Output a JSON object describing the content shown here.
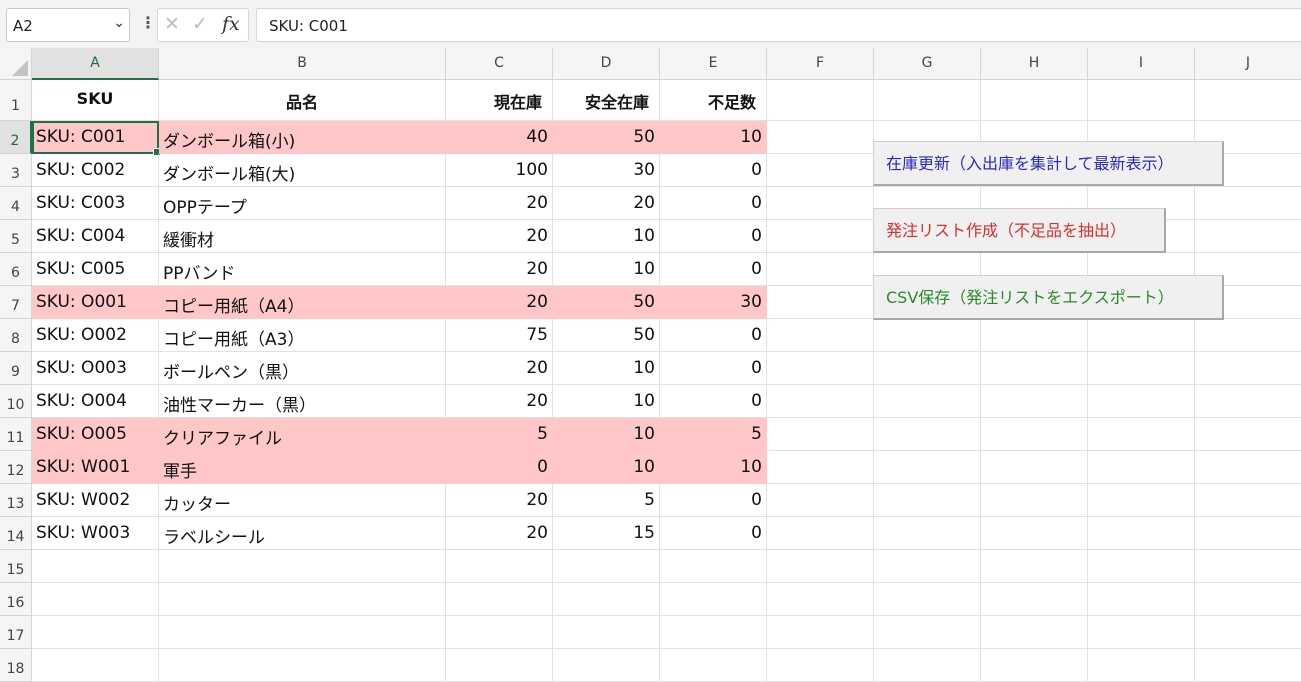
{
  "formula_bar": {
    "name_box": "A2",
    "formula": "SKU: C001"
  },
  "columns": [
    "A",
    "B",
    "C",
    "D",
    "E",
    "F",
    "G",
    "H",
    "I",
    "J"
  ],
  "rows": [
    "1",
    "2",
    "3",
    "4",
    "5",
    "6",
    "7",
    "8",
    "9",
    "10",
    "11",
    "12",
    "13",
    "14",
    "15",
    "16",
    "17",
    "18"
  ],
  "header": {
    "sku": "SKU",
    "name": "品名",
    "stock": "現在庫",
    "safety": "安全在庫",
    "shortage": "不足数"
  },
  "items": [
    {
      "sku": "SKU: C001",
      "name": "ダンボール箱(小)",
      "stock": "40",
      "safety": "50",
      "shortage": "10",
      "low": true
    },
    {
      "sku": "SKU: C002",
      "name": "ダンボール箱(大)",
      "stock": "100",
      "safety": "30",
      "shortage": "0",
      "low": false
    },
    {
      "sku": "SKU: C003",
      "name": "OPPテープ",
      "stock": "20",
      "safety": "20",
      "shortage": "0",
      "low": false
    },
    {
      "sku": "SKU: C004",
      "name": "緩衝材",
      "stock": "20",
      "safety": "10",
      "shortage": "0",
      "low": false
    },
    {
      "sku": "SKU: C005",
      "name": "PPバンド",
      "stock": "20",
      "safety": "10",
      "shortage": "0",
      "low": false
    },
    {
      "sku": "SKU: O001",
      "name": "コピー用紙（A4）",
      "stock": "20",
      "safety": "50",
      "shortage": "30",
      "low": true
    },
    {
      "sku": "SKU: O002",
      "name": "コピー用紙（A3）",
      "stock": "75",
      "safety": "50",
      "shortage": "0",
      "low": false
    },
    {
      "sku": "SKU: O003",
      "name": "ボールペン（黒）",
      "stock": "20",
      "safety": "10",
      "shortage": "0",
      "low": false
    },
    {
      "sku": "SKU: O004",
      "name": "油性マーカー（黒）",
      "stock": "20",
      "safety": "10",
      "shortage": "0",
      "low": false
    },
    {
      "sku": "SKU: O005",
      "name": "クリアファイル",
      "stock": "5",
      "safety": "10",
      "shortage": "5",
      "low": true
    },
    {
      "sku": "SKU: W001",
      "name": "軍手",
      "stock": "0",
      "safety": "10",
      "shortage": "10",
      "low": true
    },
    {
      "sku": "SKU: W002",
      "name": "カッター",
      "stock": "20",
      "safety": "5",
      "shortage": "0",
      "low": false
    },
    {
      "sku": "SKU: W003",
      "name": "ラベルシール",
      "stock": "20",
      "safety": "15",
      "shortage": "0",
      "low": false
    }
  ],
  "buttons": {
    "update": {
      "label": "在庫更新（入出庫を集計して最新表示）",
      "color": "#2929c8"
    },
    "order": {
      "label": "発注リスト作成（不足品を抽出）",
      "color": "#d63030"
    },
    "csv": {
      "label": "CSV保存（発注リストをエクスポート）",
      "color": "#2a8a2a"
    }
  },
  "colors": {
    "low_stock_fill": "#ffc7c7",
    "selection": "#1e7145"
  }
}
